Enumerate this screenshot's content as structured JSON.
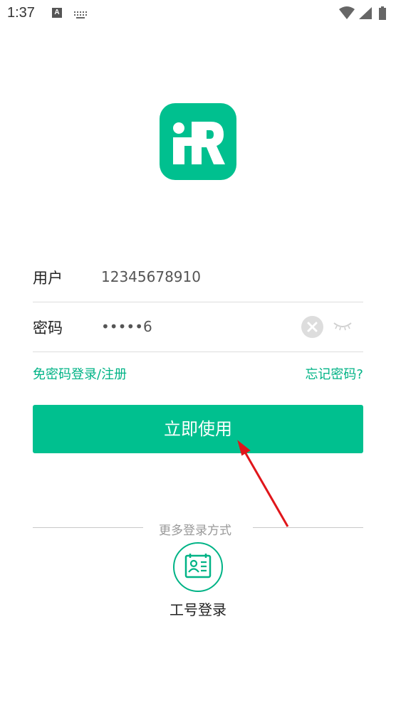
{
  "status_bar": {
    "time": "1:37",
    "icons": [
      "a-notification-icon",
      "keyboard-icon",
      "wifi-icon",
      "signal-icon",
      "battery-icon"
    ]
  },
  "logo": {
    "icon": "ihr-logo-icon",
    "color": "#00c08f",
    "text": "iR"
  },
  "form": {
    "username_label": "用户",
    "username_value": "12345678910",
    "password_label": "密码",
    "password_value": "•••••6"
  },
  "links": {
    "passwordless": "免密码登录/注册",
    "forgot": "忘记密码?"
  },
  "submit_label": "立即使用",
  "more_login": {
    "divider_text": "更多登录方式",
    "employee_login_label": "工号登录",
    "icon": "employee-badge-icon"
  },
  "colors": {
    "accent": "#00c08f",
    "link": "#00b386",
    "annotation_arrow": "#e0161b"
  }
}
